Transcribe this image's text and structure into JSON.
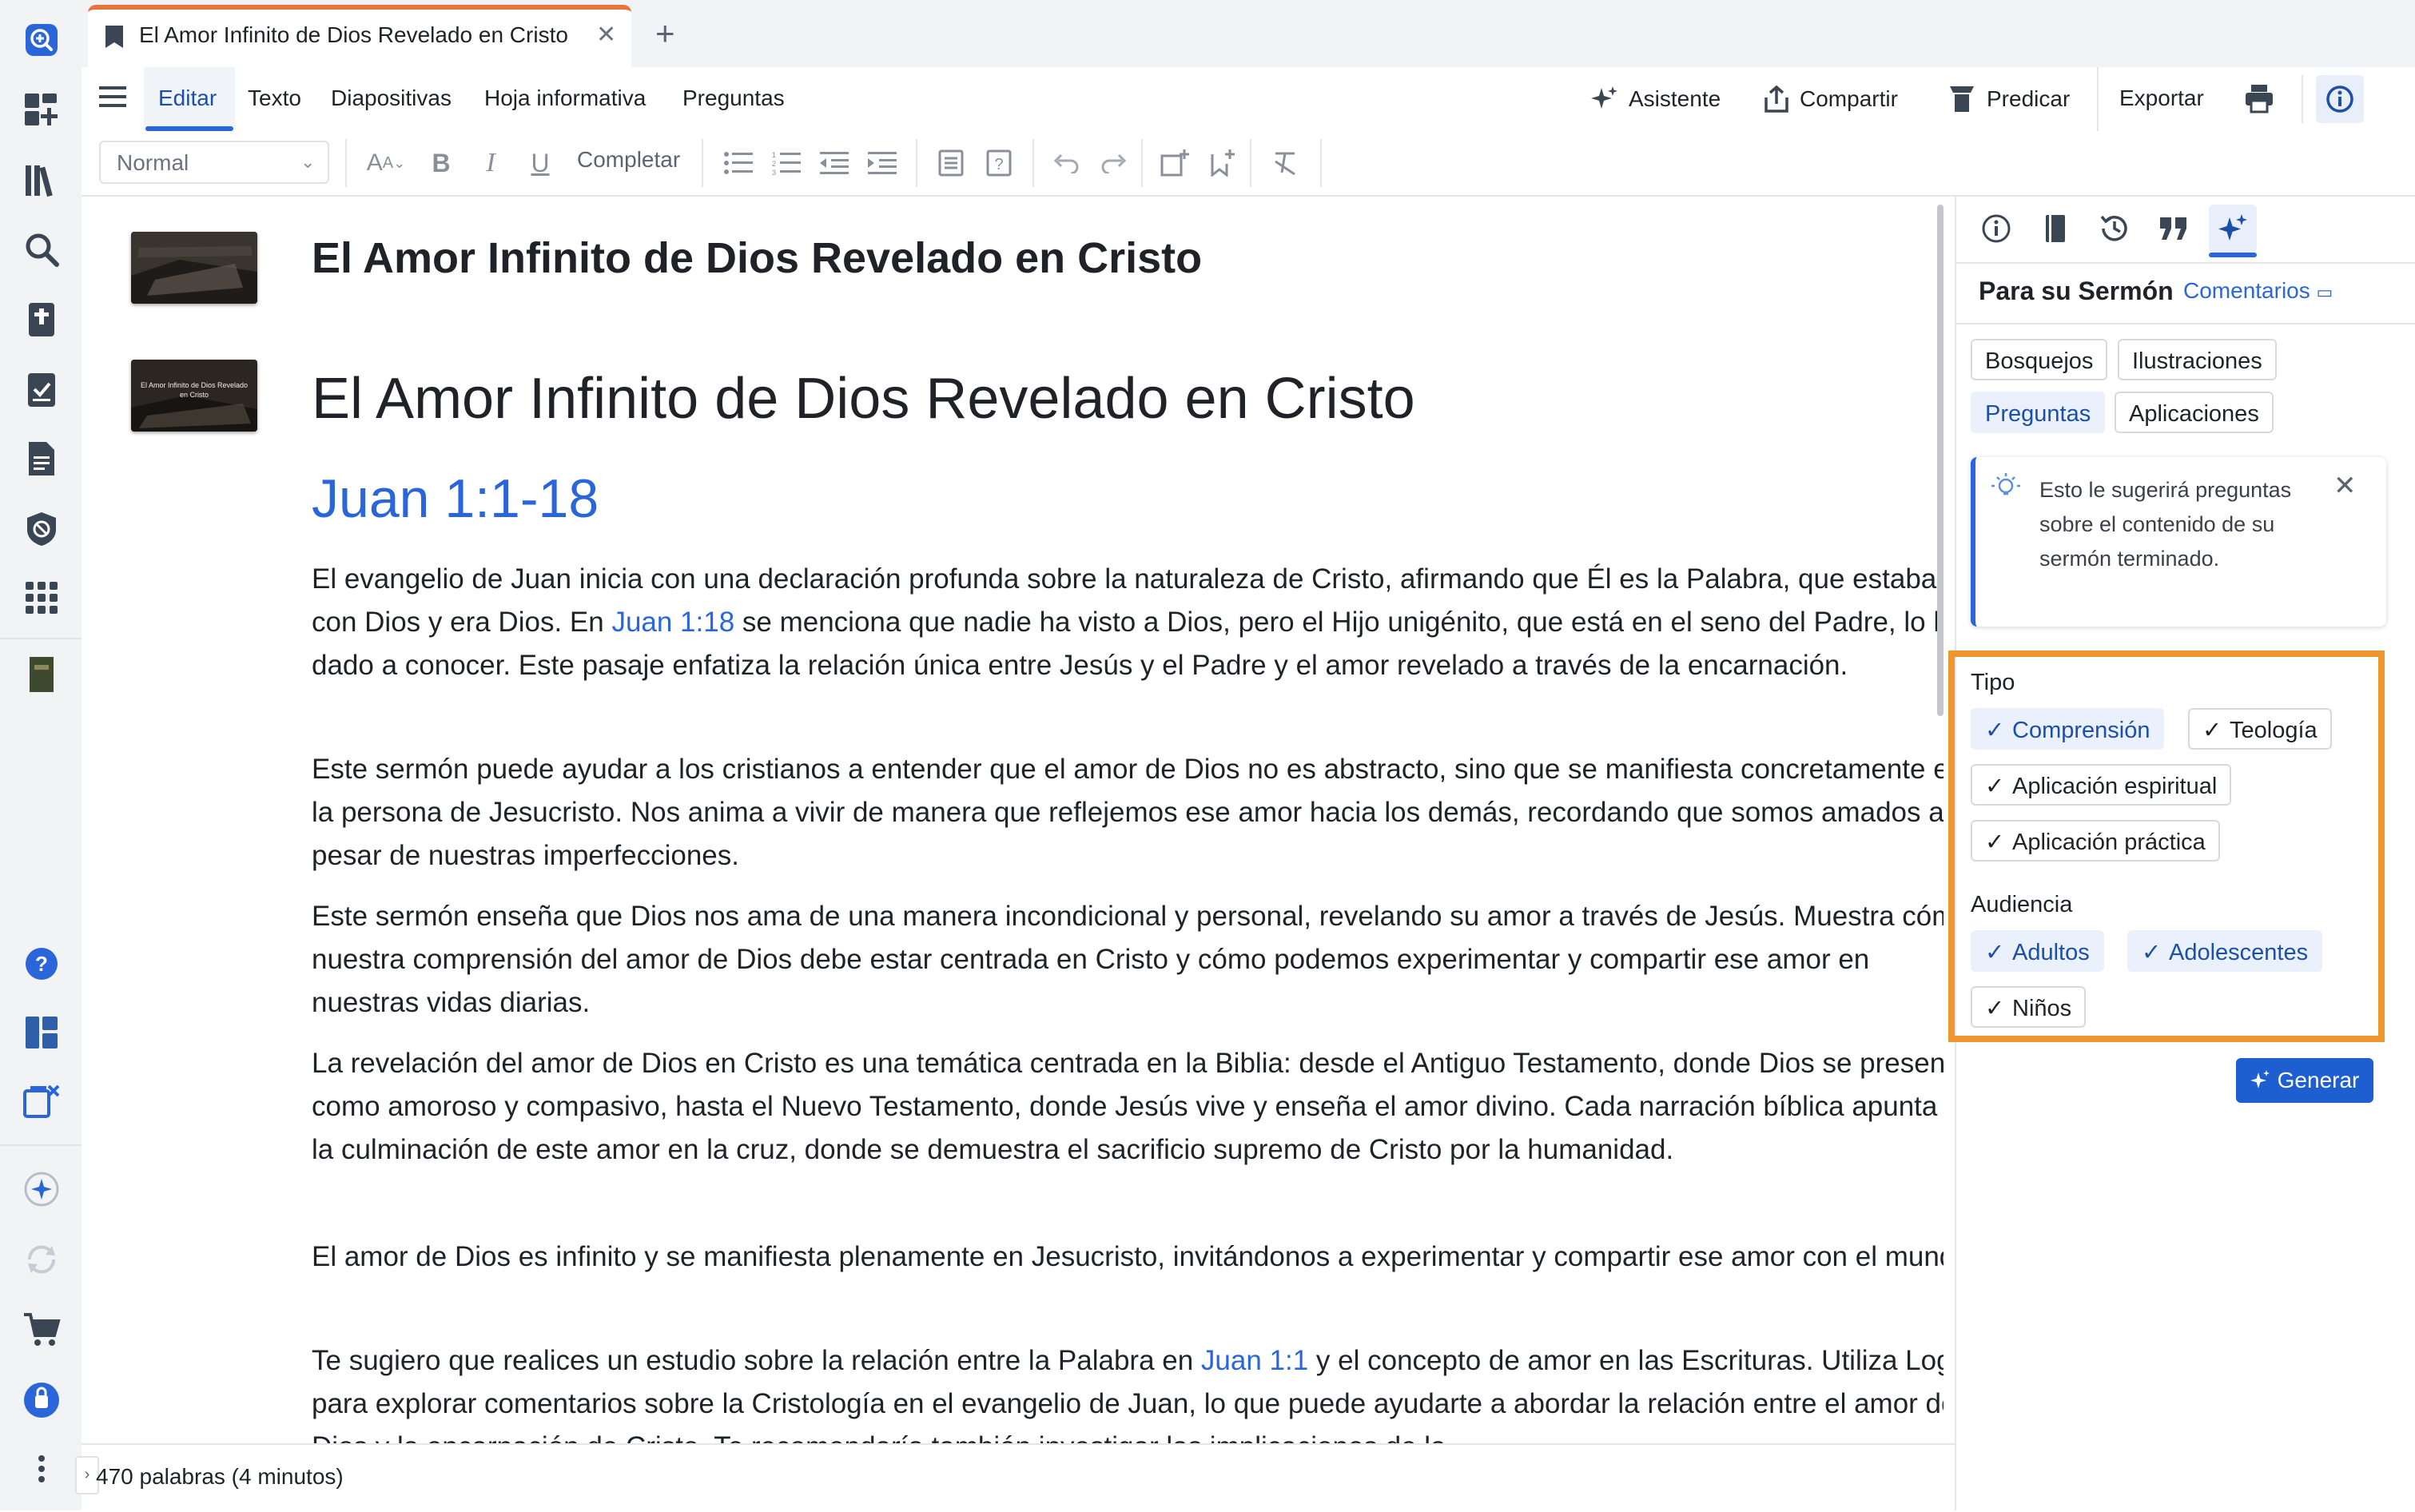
{
  "tab": {
    "title": "El Amor Infinito de Dios Revelado en Cristo"
  },
  "menu": {
    "items": [
      "Editar",
      "Texto",
      "Diapositivas",
      "Hoja informativa",
      "Preguntas"
    ],
    "right": {
      "asistente": "Asistente",
      "compartir": "Compartir",
      "predicar": "Predicar",
      "exportar": "Exportar"
    }
  },
  "toolbar": {
    "style_select": "Normal",
    "completar": "Completar"
  },
  "doc": {
    "slide_title": "El Amor Infinito de Dios Revelado en Cristo",
    "thumb2_text": "El Amor Infinito de Dios Revelado en Cristo",
    "heading": "El Amor Infinito de Dios Revelado en Cristo",
    "scripture": "Juan 1:1-18",
    "p1a": "El evangelio de Juan inicia con una declaración profunda sobre la naturaleza de Cristo, afirmando que Él es la Palabra, que estaba con Dios y era Dios. En ",
    "p1ref": "Juan 1:18",
    "p1b": " se menciona que nadie ha visto a Dios, pero el Hijo unigénito, que está en el seno del Padre, lo ha dado a conocer. Este pasaje enfatiza la relación única entre Jesús y el Padre y el amor revelado a través de la encarnación.",
    "p2": "Este sermón puede ayudar a los cristianos a entender que el amor de Dios no es abstracto, sino que se manifiesta concretamente en la persona de Jesucristo. Nos anima a vivir de manera que reflejemos ese amor hacia los demás, recordando que somos amados a pesar de nuestras imperfecciones.",
    "p3": "Este sermón enseña que Dios nos ama de una manera incondicional y personal, revelando su amor a través de Jesús. Muestra cómo nuestra comprensión del amor de Dios debe estar centrada en Cristo y cómo podemos experimentar y compartir ese amor en nuestras vidas diarias.",
    "p4": "La revelación del amor de Dios en Cristo es una temática centrada en la Biblia: desde el Antiguo Testamento, donde Dios se presenta como amoroso y compasivo, hasta el Nuevo Testamento, donde Jesús vive y enseña el amor divino. Cada narración bíblica apunta a la culminación de este amor en la cruz, donde se demuestra el sacrificio supremo de Cristo por la humanidad.",
    "p5": "El amor de Dios es infinito y se manifiesta plenamente en Jesucristo, invitándonos a experimentar y compartir ese amor con el mundo.",
    "p6a": "Te sugiero que realices un estudio sobre la relación entre la Palabra en ",
    "p6ref": "Juan 1:1",
    "p6b": " y el concepto de amor en las Escrituras. Utiliza Logos para explorar comentarios sobre la Cristología en el evangelio de Juan, lo que puede ayudarte a abordar la relación entre el amor de Dios y la encarnación de Cristo. Te recomendaría también investigar las implicaciones de la"
  },
  "status": {
    "word_count": "470 palabras (4 minutos)"
  },
  "panel": {
    "title": "Para su Sermón",
    "comentarios": "Comentarios",
    "categories": [
      "Bosquejos",
      "Ilustraciones",
      "Preguntas",
      "Aplicaciones"
    ],
    "tip": "Esto le sugerirá preguntas sobre el contenido de su sermón terminado.",
    "tipo_label": "Tipo",
    "tipo_options": [
      "Comprensión",
      "Teología",
      "Aplicación espiritual",
      "Aplicación práctica"
    ],
    "audiencia_label": "Audiencia",
    "audiencia_options": [
      "Adultos",
      "Adolescentes",
      "Niños"
    ],
    "generar": "Generar"
  },
  "colors": {
    "accent": "#2a66d9",
    "highlight_border": "#f0962f",
    "tab_accent": "#e8743b",
    "primary_button": "#1d5fd0"
  }
}
